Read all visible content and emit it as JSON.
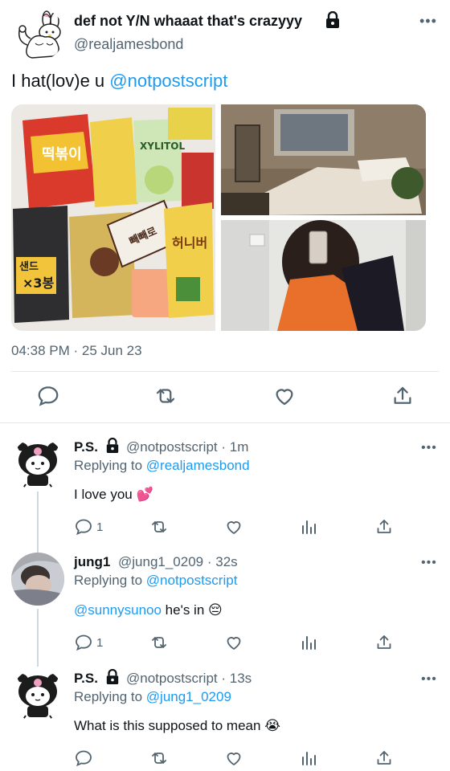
{
  "tweet": {
    "display_name": "def not Y/N whaaat that's crazyyy",
    "handle": "@realjamesbond",
    "text_prefix": "I hat(lov)e u ",
    "mention": "@notpostscript",
    "timestamp": "04:38 PM · 25 Jun 23",
    "more": "•••"
  },
  "replies": [
    {
      "name": "P.S.",
      "handle_time": "@notpostscript · 1m",
      "replying_label": "Replying to ",
      "replying_to": "@realjamesbond",
      "text": "I love you 💕",
      "reply_count": "1",
      "more": "•••"
    },
    {
      "name": "jung1",
      "handle_time": "@jung1_0209 · 32s",
      "replying_label": "Replying to ",
      "replying_to": "@notpostscript",
      "text_mention": "@sunnysunoo",
      "text": " he's in 😔",
      "reply_count": "1",
      "more": "•••"
    },
    {
      "name": "P.S.",
      "handle_time": "@notpostscript · 13s",
      "replying_label": "Replying to ",
      "replying_to": "@jung1_0209",
      "text": "What is this supposed to mean 😭",
      "more": "•••"
    }
  ],
  "media_text": {
    "snack_1": "떡볶이",
    "snack_2": "XYLITOL",
    "snack_3": "허니버",
    "snack_4": "빼빼로",
    "snack_5": "×3봉",
    "snack_6": "샌드"
  },
  "colors": {
    "accent": "#1d9bf0",
    "text": "#0f1419",
    "secondary": "#536471"
  },
  "icons": [
    "lock-icon",
    "more-icon",
    "reply-icon",
    "retweet-icon",
    "like-icon",
    "share-icon",
    "analytics-icon"
  ]
}
